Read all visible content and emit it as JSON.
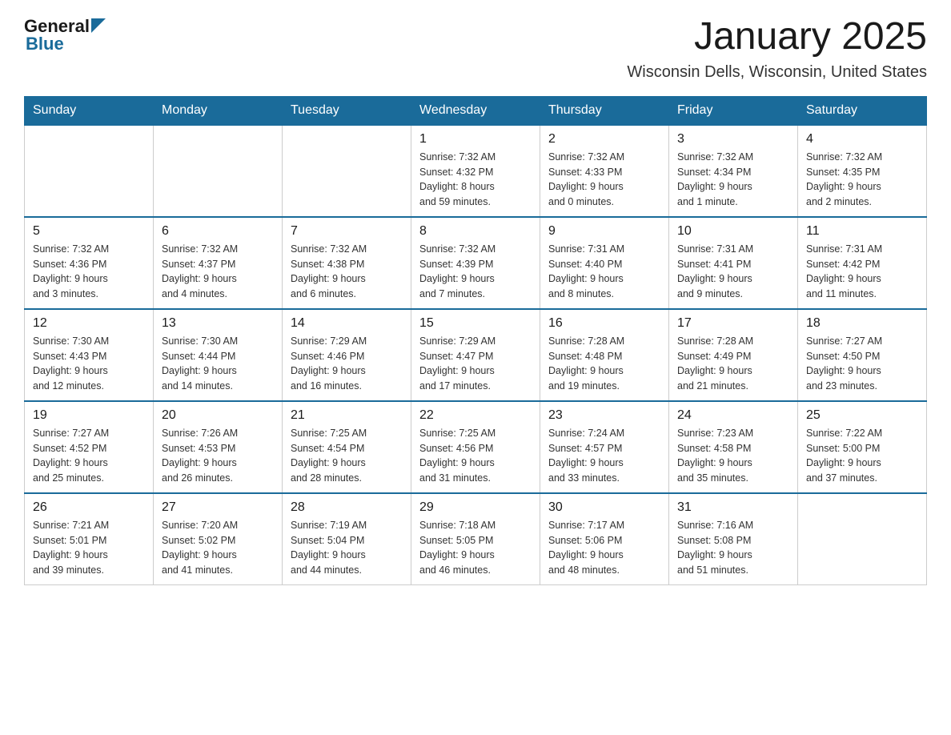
{
  "header": {
    "logo_general": "General",
    "logo_blue": "Blue",
    "title": "January 2025",
    "subtitle": "Wisconsin Dells, Wisconsin, United States"
  },
  "days_of_week": [
    "Sunday",
    "Monday",
    "Tuesday",
    "Wednesday",
    "Thursday",
    "Friday",
    "Saturday"
  ],
  "weeks": [
    {
      "days": [
        {
          "number": "",
          "info": ""
        },
        {
          "number": "",
          "info": ""
        },
        {
          "number": "",
          "info": ""
        },
        {
          "number": "1",
          "info": "Sunrise: 7:32 AM\nSunset: 4:32 PM\nDaylight: 8 hours\nand 59 minutes."
        },
        {
          "number": "2",
          "info": "Sunrise: 7:32 AM\nSunset: 4:33 PM\nDaylight: 9 hours\nand 0 minutes."
        },
        {
          "number": "3",
          "info": "Sunrise: 7:32 AM\nSunset: 4:34 PM\nDaylight: 9 hours\nand 1 minute."
        },
        {
          "number": "4",
          "info": "Sunrise: 7:32 AM\nSunset: 4:35 PM\nDaylight: 9 hours\nand 2 minutes."
        }
      ]
    },
    {
      "days": [
        {
          "number": "5",
          "info": "Sunrise: 7:32 AM\nSunset: 4:36 PM\nDaylight: 9 hours\nand 3 minutes."
        },
        {
          "number": "6",
          "info": "Sunrise: 7:32 AM\nSunset: 4:37 PM\nDaylight: 9 hours\nand 4 minutes."
        },
        {
          "number": "7",
          "info": "Sunrise: 7:32 AM\nSunset: 4:38 PM\nDaylight: 9 hours\nand 6 minutes."
        },
        {
          "number": "8",
          "info": "Sunrise: 7:32 AM\nSunset: 4:39 PM\nDaylight: 9 hours\nand 7 minutes."
        },
        {
          "number": "9",
          "info": "Sunrise: 7:31 AM\nSunset: 4:40 PM\nDaylight: 9 hours\nand 8 minutes."
        },
        {
          "number": "10",
          "info": "Sunrise: 7:31 AM\nSunset: 4:41 PM\nDaylight: 9 hours\nand 9 minutes."
        },
        {
          "number": "11",
          "info": "Sunrise: 7:31 AM\nSunset: 4:42 PM\nDaylight: 9 hours\nand 11 minutes."
        }
      ]
    },
    {
      "days": [
        {
          "number": "12",
          "info": "Sunrise: 7:30 AM\nSunset: 4:43 PM\nDaylight: 9 hours\nand 12 minutes."
        },
        {
          "number": "13",
          "info": "Sunrise: 7:30 AM\nSunset: 4:44 PM\nDaylight: 9 hours\nand 14 minutes."
        },
        {
          "number": "14",
          "info": "Sunrise: 7:29 AM\nSunset: 4:46 PM\nDaylight: 9 hours\nand 16 minutes."
        },
        {
          "number": "15",
          "info": "Sunrise: 7:29 AM\nSunset: 4:47 PM\nDaylight: 9 hours\nand 17 minutes."
        },
        {
          "number": "16",
          "info": "Sunrise: 7:28 AM\nSunset: 4:48 PM\nDaylight: 9 hours\nand 19 minutes."
        },
        {
          "number": "17",
          "info": "Sunrise: 7:28 AM\nSunset: 4:49 PM\nDaylight: 9 hours\nand 21 minutes."
        },
        {
          "number": "18",
          "info": "Sunrise: 7:27 AM\nSunset: 4:50 PM\nDaylight: 9 hours\nand 23 minutes."
        }
      ]
    },
    {
      "days": [
        {
          "number": "19",
          "info": "Sunrise: 7:27 AM\nSunset: 4:52 PM\nDaylight: 9 hours\nand 25 minutes."
        },
        {
          "number": "20",
          "info": "Sunrise: 7:26 AM\nSunset: 4:53 PM\nDaylight: 9 hours\nand 26 minutes."
        },
        {
          "number": "21",
          "info": "Sunrise: 7:25 AM\nSunset: 4:54 PM\nDaylight: 9 hours\nand 28 minutes."
        },
        {
          "number": "22",
          "info": "Sunrise: 7:25 AM\nSunset: 4:56 PM\nDaylight: 9 hours\nand 31 minutes."
        },
        {
          "number": "23",
          "info": "Sunrise: 7:24 AM\nSunset: 4:57 PM\nDaylight: 9 hours\nand 33 minutes."
        },
        {
          "number": "24",
          "info": "Sunrise: 7:23 AM\nSunset: 4:58 PM\nDaylight: 9 hours\nand 35 minutes."
        },
        {
          "number": "25",
          "info": "Sunrise: 7:22 AM\nSunset: 5:00 PM\nDaylight: 9 hours\nand 37 minutes."
        }
      ]
    },
    {
      "days": [
        {
          "number": "26",
          "info": "Sunrise: 7:21 AM\nSunset: 5:01 PM\nDaylight: 9 hours\nand 39 minutes."
        },
        {
          "number": "27",
          "info": "Sunrise: 7:20 AM\nSunset: 5:02 PM\nDaylight: 9 hours\nand 41 minutes."
        },
        {
          "number": "28",
          "info": "Sunrise: 7:19 AM\nSunset: 5:04 PM\nDaylight: 9 hours\nand 44 minutes."
        },
        {
          "number": "29",
          "info": "Sunrise: 7:18 AM\nSunset: 5:05 PM\nDaylight: 9 hours\nand 46 minutes."
        },
        {
          "number": "30",
          "info": "Sunrise: 7:17 AM\nSunset: 5:06 PM\nDaylight: 9 hours\nand 48 minutes."
        },
        {
          "number": "31",
          "info": "Sunrise: 7:16 AM\nSunset: 5:08 PM\nDaylight: 9 hours\nand 51 minutes."
        },
        {
          "number": "",
          "info": ""
        }
      ]
    }
  ]
}
